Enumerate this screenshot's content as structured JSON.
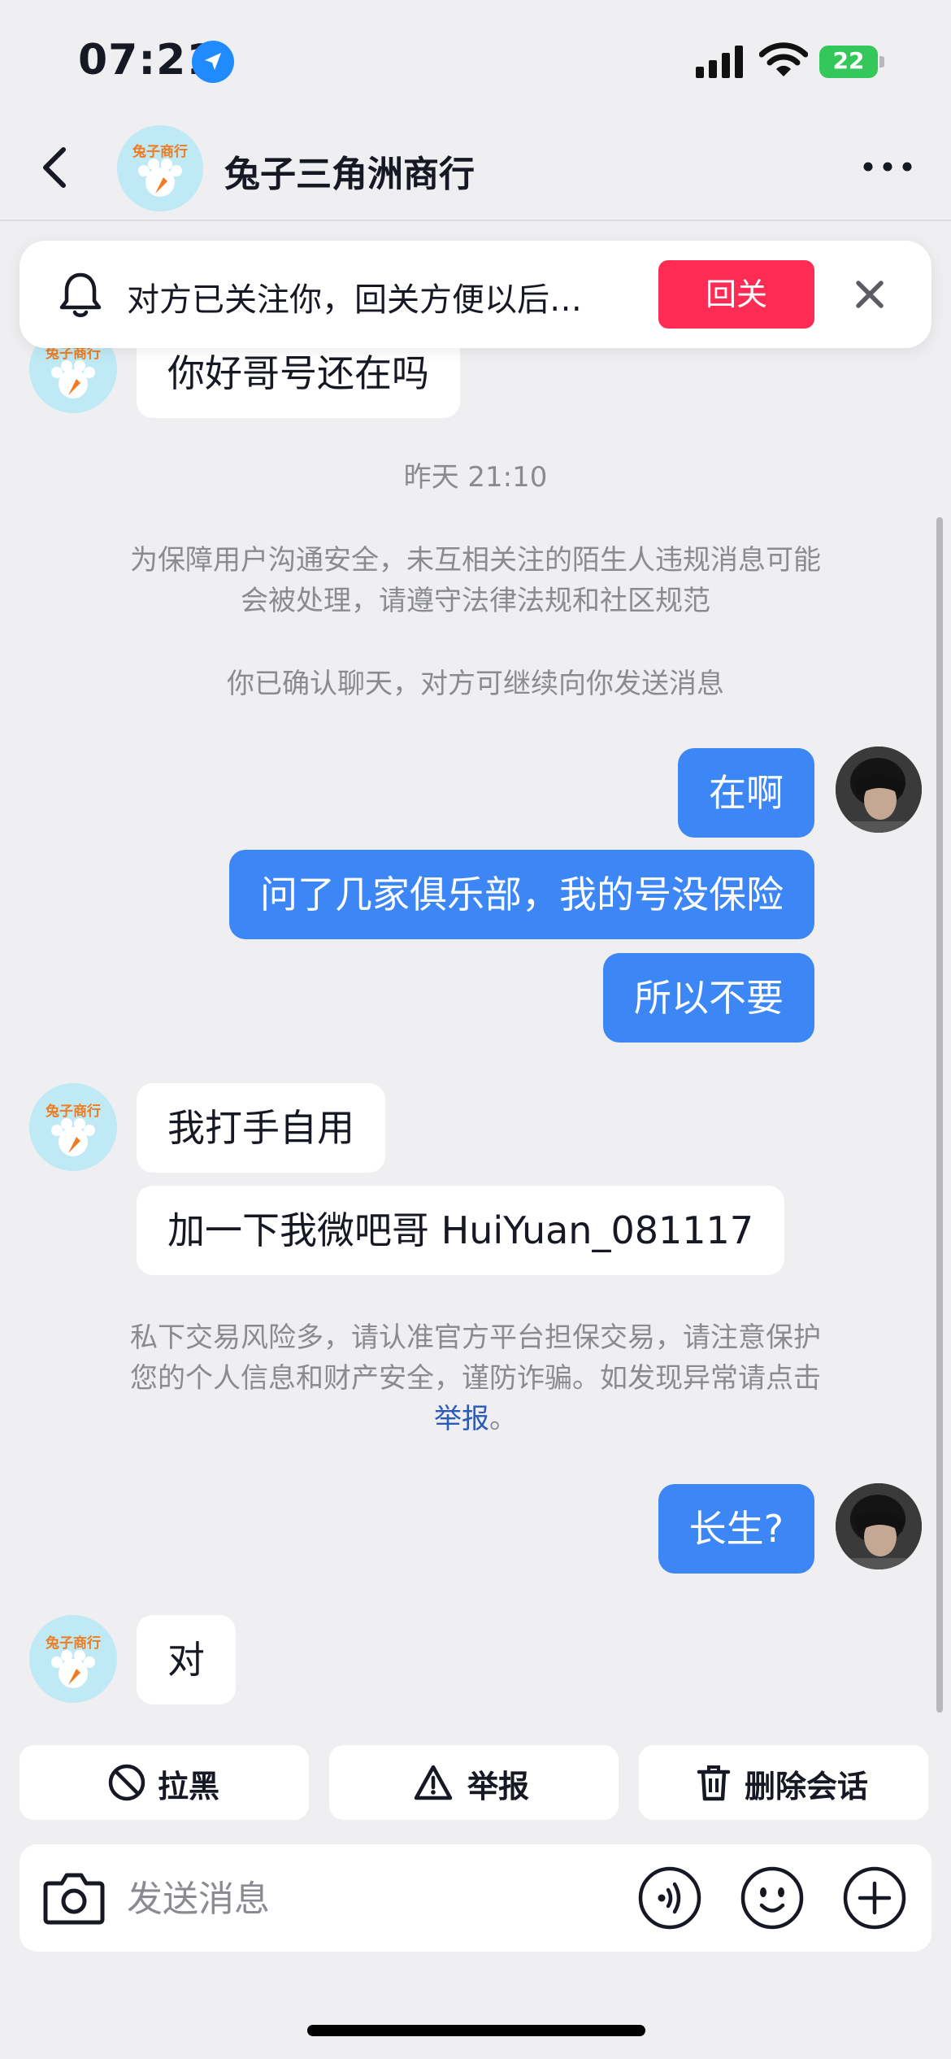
{
  "status_bar": {
    "time": "07:21",
    "battery": "22"
  },
  "header": {
    "title": "兔子三角洲商行",
    "avatar_text": "兔子商行"
  },
  "follow_banner": {
    "text": "对方已关注你，回关方便以后…",
    "button": "回关"
  },
  "messages": [
    {
      "side": "in",
      "text": "你好哥号还在吗"
    },
    {
      "type": "time",
      "text": "昨天 21:10"
    },
    {
      "type": "system",
      "text": "为保障用户沟通安全，未互相关注的陌生人违规消息可能会被处理，请遵守法律法规和社区规范"
    },
    {
      "type": "system",
      "text": "你已确认聊天，对方可继续向你发送消息"
    },
    {
      "side": "out",
      "text": "在啊"
    },
    {
      "side": "out",
      "text": "问了几家俱乐部，我的号没保险"
    },
    {
      "side": "out",
      "text": "所以不要"
    },
    {
      "side": "in",
      "text": "我打手自用"
    },
    {
      "side": "in",
      "text": "加一下我微吧哥 HuiYuan_081117"
    },
    {
      "type": "system",
      "text_before": "私下交易风险多，请认准官方平台担保交易，请注意保护您的个人信息和财产安全，谨防诈骗。如发现异常请点击",
      "link": "举报",
      "text_after": "。"
    },
    {
      "side": "out",
      "text": "长生?"
    },
    {
      "side": "in",
      "text": "对"
    }
  ],
  "actions": {
    "block": "拉黑",
    "report": "举报",
    "delete": "删除会话"
  },
  "input": {
    "placeholder": "发送消息"
  },
  "colors": {
    "accent": "#fe2c55",
    "bubble_out": "#3c87f5",
    "background": "#efeff1"
  }
}
